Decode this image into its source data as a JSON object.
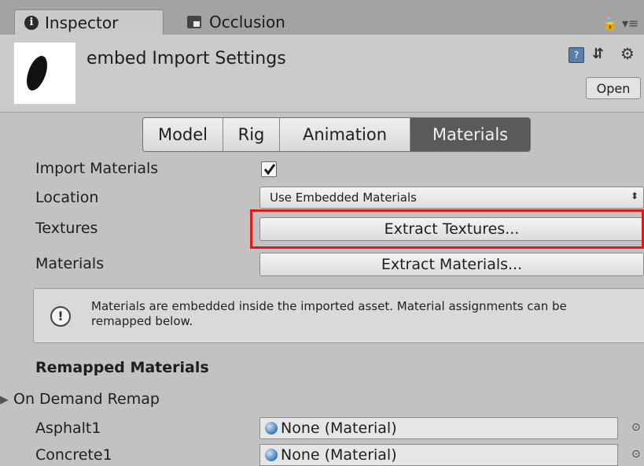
{
  "tabs": {
    "inspector": "Inspector",
    "occlusion": "Occlusion",
    "lock_glyph": "🔒 ▾≡"
  },
  "header": {
    "title": "embed Import Settings",
    "open_label": "Open",
    "help_glyph": "?",
    "preset_glyph": "⇵",
    "gear_glyph": "⚙"
  },
  "toolbar": {
    "tabs": [
      "Model",
      "Rig",
      "Animation",
      "Materials"
    ],
    "active": "Materials"
  },
  "properties": {
    "import_materials_label": "Import Materials",
    "import_materials_checked": true,
    "location_label": "Location",
    "location_value": "Use Embedded Materials",
    "location_arrow": "⬍",
    "textures_label": "Textures",
    "extract_textures_label": "Extract Textures...",
    "materials_label": "Materials",
    "extract_materials_label": "Extract Materials..."
  },
  "help": {
    "icon_glyph": "!",
    "text": "Materials are embedded inside the imported asset. Material assignments can be remapped below."
  },
  "remapped": {
    "heading": "Remapped Materials",
    "on_demand_label": "On Demand Remap",
    "arrow": "▶",
    "items": [
      {
        "name": "Asphalt1",
        "value": "None (Material)"
      },
      {
        "name": "Concrete1",
        "value": "None (Material)"
      }
    ],
    "picker_glyph": "⊙"
  },
  "colors": {
    "panel_bg": "#c2c2c2",
    "active_tab": "#5a5a5a",
    "highlight": "#e01818"
  }
}
